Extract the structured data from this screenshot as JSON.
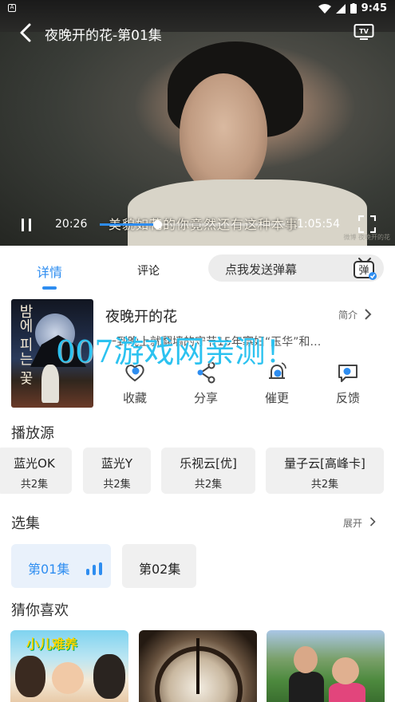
{
  "status_bar": {
    "time": "9:45"
  },
  "player": {
    "title": "夜晚开的花-第01集",
    "subtitle": "美貌如花的你竟然还有这种本事",
    "current_time": "20:26",
    "total_time": "1:05:54",
    "progress": 0.31,
    "watermark_small": "微博 夜晚开的花"
  },
  "tabs": {
    "detail": "详情",
    "comment": "评论",
    "danmu_placeholder": "点我发送弹幕",
    "danmu_badge": "弹"
  },
  "show": {
    "title": "夜晚开的花",
    "intro_label": "简介",
    "description": "一到晚上就翻墙的守节15年寡妇“玉华”和…",
    "poster_text": "밤에 피는 꽃"
  },
  "overlay_watermark": "007游戏网亲测！",
  "actions": [
    {
      "label": "收藏",
      "icon": "heart-icon"
    },
    {
      "label": "分享",
      "icon": "share-icon"
    },
    {
      "label": "催更",
      "icon": "bell-icon"
    },
    {
      "label": "反馈",
      "icon": "feedback-icon"
    }
  ],
  "sources": {
    "title": "播放源",
    "items": [
      {
        "name": "蓝光OK",
        "count": "共2集"
      },
      {
        "name": "蓝光Y",
        "count": "共2集"
      },
      {
        "name": "乐视云[优]",
        "count": "共2集"
      },
      {
        "name": "量子云[高峰卡]",
        "count": "共2集"
      }
    ]
  },
  "episodes": {
    "title": "选集",
    "expand_label": "展开",
    "items": [
      {
        "label": "第01集"
      },
      {
        "label": "第02集"
      }
    ]
  },
  "recommend": {
    "title": "猜你喜欢",
    "rec1_title": "小儿难养"
  },
  "colors": {
    "accent": "#2e8df0",
    "watermark": "#2cc2f0"
  }
}
